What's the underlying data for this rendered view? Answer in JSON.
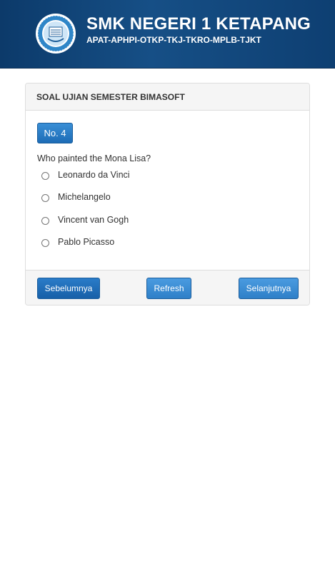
{
  "header": {
    "school_name": "SMK NEGERI 1 KETAPANG",
    "programs": "APAT-APHPI-OTKP-TKJ-TKRO-MPLB-TJKT",
    "logo_icon": "school-emblem-icon"
  },
  "panel": {
    "title": "SOAL UJIAN SEMESTER BIMASOFT",
    "question_number": "No. 4",
    "question": "Who painted the Mona Lisa?",
    "options": [
      {
        "label": "Leonardo da Vinci",
        "selected": false
      },
      {
        "label": "Michelangelo",
        "selected": false
      },
      {
        "label": "Vincent van Gogh",
        "selected": false
      },
      {
        "label": "Pablo Picasso",
        "selected": false
      }
    ]
  },
  "footer": {
    "prev_label": "Sebelumnya",
    "refresh_label": "Refresh",
    "next_label": "Selanjutnya"
  },
  "colors": {
    "header_bg": "#164f86",
    "button_blue": "#1d6cb6",
    "panel_bg": "#f5f5f5"
  }
}
